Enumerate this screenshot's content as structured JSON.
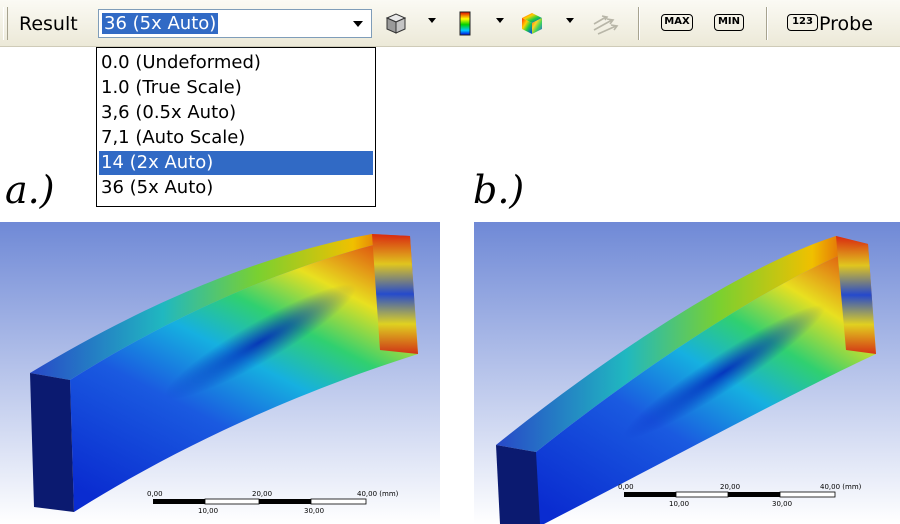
{
  "toolbar": {
    "result_label": "Result",
    "scale_combo": {
      "value": "36 (5x Auto)"
    },
    "max_label": "MAX",
    "min_label": "MIN",
    "probe_badge": "123",
    "probe_label": "Probe",
    "icons": [
      "geometry-cube-icon",
      "contour-colors-icon",
      "edges-display-icon",
      "vector-arrows-icon"
    ]
  },
  "dropdown": {
    "items": [
      "0.0 (Undeformed)",
      "1.0 (True Scale)",
      "3,6 (0.5x Auto)",
      "7,1 (Auto Scale)",
      "14 (2x Auto)",
      "36 (5x Auto)"
    ],
    "selected_index": 4
  },
  "panels": [
    {
      "label": "a.)",
      "scale_bar": {
        "ticks_top": [
          "0,00",
          "20,00",
          "40,00 (mm)"
        ],
        "ticks_bottom": [
          "10,00",
          "30,00"
        ]
      }
    },
    {
      "label": "b.)",
      "scale_bar": {
        "ticks_top": [
          "0,00",
          "20,00",
          "40,00 (mm)"
        ],
        "ticks_bottom": [
          "10,00",
          "30,00"
        ]
      }
    }
  ],
  "colors": {
    "selection": "#316ac5",
    "viewport_top": "#6f89d6",
    "viewport_bottom": "#ffffff",
    "beam_blue": "#0a2fd0",
    "beam_red": "#d01818"
  }
}
